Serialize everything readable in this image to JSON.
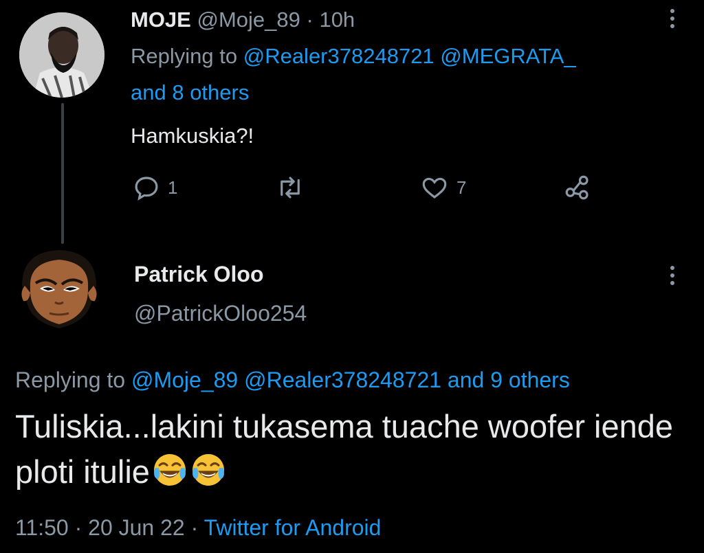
{
  "tweet1": {
    "display_name": "MOJE",
    "handle": "@Moje_89",
    "separator": "·",
    "time": "10h",
    "replying_prefix": "Replying to",
    "reply_handles": "@Realer378248721 @MEGRATA_",
    "reply_others": "and 8 others",
    "text": "Hamkuskia?!",
    "reply_count": "1",
    "like_count": "7"
  },
  "tweet2": {
    "display_name": "Patrick Oloo",
    "handle": "@PatrickOloo254",
    "replying_prefix": "Replying to",
    "reply_targets": "@Moje_89 @Realer378248721 and 9 others",
    "text": "Tuliskia...lakini tukasema tuache woofer iende ploti itulie",
    "time": "11:50",
    "separator": "·",
    "date": "20 Jun 22",
    "separator2": "·",
    "source": "Twitter for Android"
  },
  "icons": [
    "more-icon",
    "reply-icon",
    "retweet-icon",
    "like-icon",
    "share-icon",
    "tears-of-joy-emoji"
  ],
  "colors": {
    "background": "#000000",
    "text": "#e7e9ea",
    "muted": "#8b98a5",
    "link": "#1d9bf0"
  }
}
